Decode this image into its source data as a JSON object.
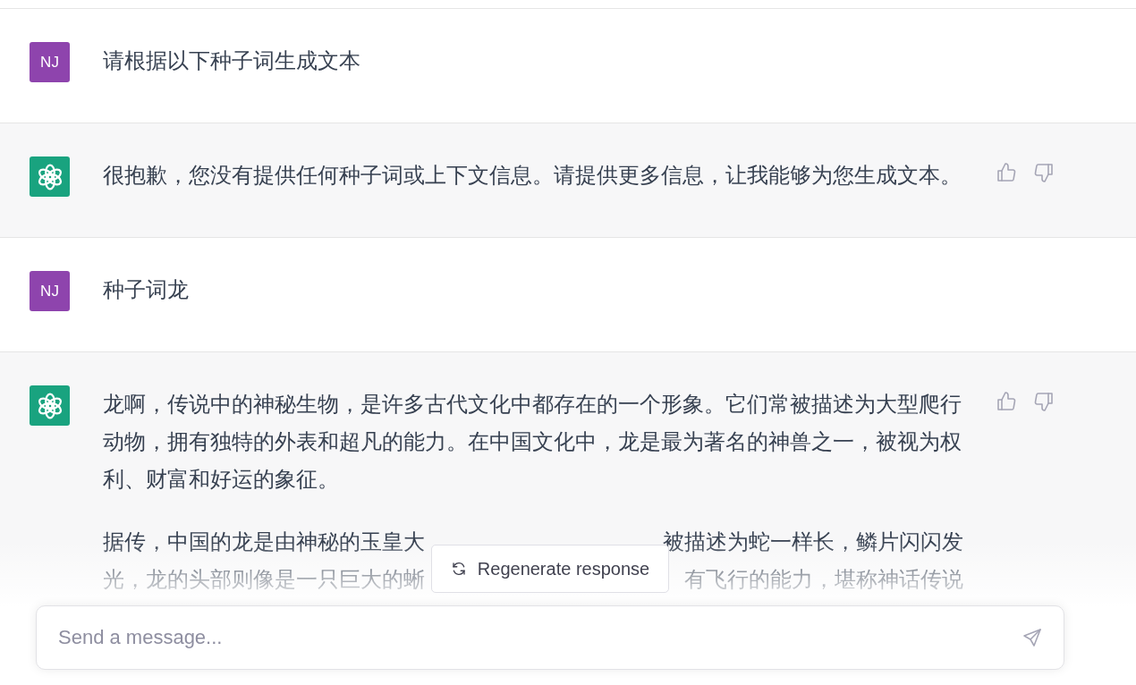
{
  "messages": [
    {
      "kind": "user",
      "avatar": "NJ",
      "paragraphs": [
        {
          "kind": "text",
          "text": "请根据以下种子词生成文本"
        }
      ]
    },
    {
      "kind": "assistant",
      "paragraphs": [
        {
          "kind": "text",
          "text": "很抱歉，您没有提供任何种子词或上下文信息。请提供更多信息，让我能够为您生成文本。"
        }
      ]
    },
    {
      "kind": "user",
      "avatar": "NJ",
      "paragraphs": [
        {
          "kind": "text",
          "text": "种子词龙"
        }
      ]
    },
    {
      "kind": "assistant",
      "paragraphs": [
        {
          "kind": "text",
          "text": "龙啊，传说中的神秘生物，是许多古代文化中都存在的一个形象。它们常被描述为大型爬行动物，拥有独特的外表和超凡的能力。在中国文化中，龙是最为著名的神兽之一，被视为权利、财富和好运的象征。"
        },
        {
          "kind": "split",
          "lines": [
            [
              "据传，中国的龙是由神秘的玉皇大",
              "被描述为蛇一样长，鳞片闪闪发"
            ],
            [
              "光，龙的头部则像是一只巨大的蜥",
              "有飞行的能力，堪称神话传说"
            ]
          ]
        }
      ]
    }
  ],
  "regenerate_button": "Regenerate response",
  "composer": {
    "placeholder": "Send a message..."
  }
}
